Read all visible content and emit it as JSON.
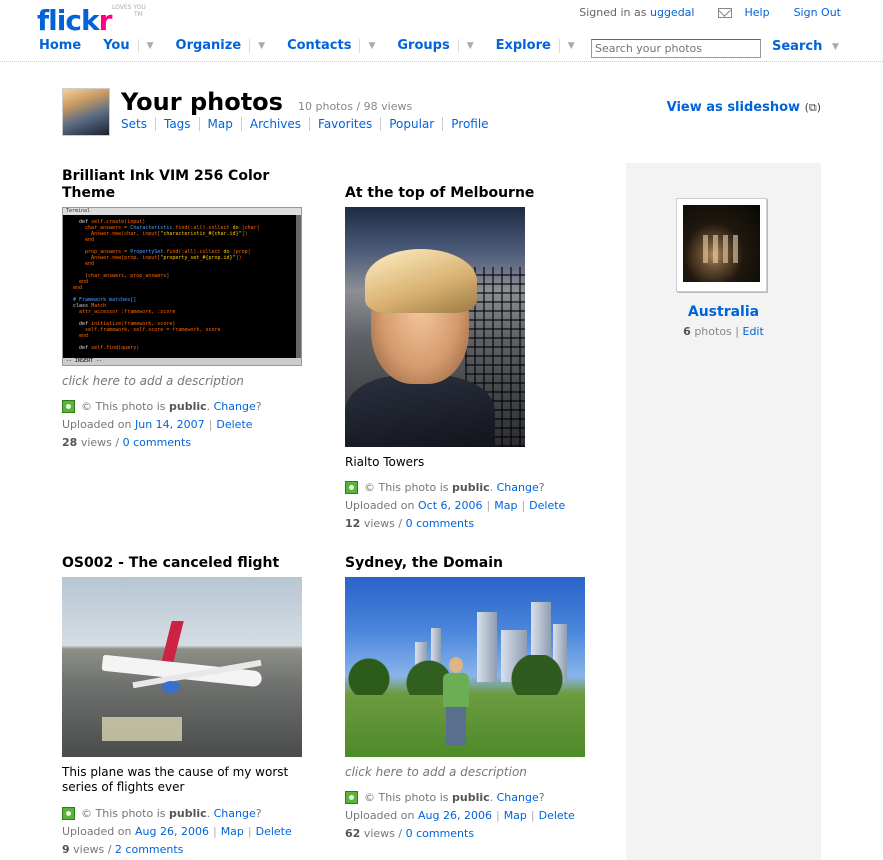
{
  "header": {
    "logo_text": "flick",
    "logo_r": "r",
    "logo_tag": "LOVES YOU",
    "tm": "TM",
    "signed_in_label": "Signed in as",
    "username": "uggedal",
    "help": "Help",
    "sign_out": "Sign Out",
    "nav": [
      {
        "label": "Home"
      },
      {
        "label": "You"
      },
      {
        "label": "Organize"
      },
      {
        "label": "Contacts"
      },
      {
        "label": "Groups"
      },
      {
        "label": "Explore"
      }
    ],
    "search_placeholder": "Search your photos",
    "search_button": "Search"
  },
  "page": {
    "title": "Your photos",
    "stats": "10 photos / 98 views",
    "subnav": [
      "Sets",
      "Tags",
      "Map",
      "Archives",
      "Favorites",
      "Popular",
      "Profile"
    ],
    "slideshow": "View as slideshow",
    "slideshow_icon": "(⧉)"
  },
  "photos": [
    {
      "title": "Brilliant Ink VIM 256 Color Theme",
      "description": "click here to add a description",
      "privacy_prefix": "© This photo is",
      "privacy": "public",
      "change": "Change",
      "uploaded_label": "Uploaded on",
      "date": "Jun 14, 2007",
      "map": "",
      "delete": "Delete",
      "views": "28",
      "views_label": "views",
      "comments": "0 comments"
    },
    {
      "title": "At the top of Melbourne",
      "description": "Rialto Towers",
      "privacy_prefix": "© This photo is",
      "privacy": "public",
      "change": "Change",
      "uploaded_label": "Uploaded on",
      "date": "Oct 6, 2006",
      "map": "Map",
      "delete": "Delete",
      "views": "12",
      "views_label": "views",
      "comments": "0 comments"
    },
    {
      "title": "OS002 - The canceled flight",
      "description": "This plane was the cause of my worst series of flights ever",
      "privacy_prefix": "© This photo is",
      "privacy": "public",
      "change": "Change",
      "uploaded_label": "Uploaded on",
      "date": "Aug 26, 2006",
      "map": "Map",
      "delete": "Delete",
      "views": "9",
      "views_label": "views",
      "comments": "2 comments"
    },
    {
      "title": "Sydney, the Domain",
      "description": "click here to add a description",
      "privacy_prefix": "© This photo is",
      "privacy": "public",
      "change": "Change",
      "uploaded_label": "Uploaded on",
      "date": "Aug 26, 2006",
      "map": "Map",
      "delete": "Delete",
      "views": "62",
      "views_label": "views",
      "comments": "0 comments"
    }
  ],
  "sidebar": {
    "set_title": "Australia",
    "set_count": "6",
    "set_count_label": "photos",
    "set_edit": "Edit"
  },
  "colors": {
    "link": "#0063dc",
    "logo_pink": "#ff0084",
    "public_badge": "#5bb33b",
    "sidebar_bg": "#f3f3f3"
  }
}
